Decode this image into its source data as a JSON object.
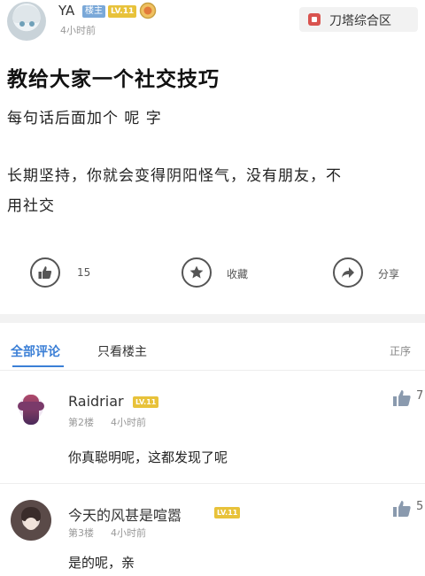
{
  "post": {
    "author": "YA",
    "author_badge": "楼主",
    "author_level": "LV.11",
    "time": "4小时前",
    "forum": "刀塔综合区",
    "title": "教给大家一个社交技巧",
    "body_lines": [
      "每句话后面加个 呢 字",
      "长期坚持，你就会变得阴阳怪气，没有朋友，不",
      "用社交"
    ],
    "actions": {
      "like_count": "15",
      "favorite_label": "收藏",
      "share_label": "分享"
    }
  },
  "tabs": {
    "all": "全部评论",
    "op_only": "只看楼主",
    "sort": "正序"
  },
  "comments": [
    {
      "name": "Raidriar",
      "level": "LV.11",
      "floor": "第2楼",
      "time": "4小时前",
      "text": "你真聪明呢，这都发现了呢",
      "likes": "7"
    },
    {
      "name": "今天的风甚是喧嚣",
      "level": "LV.11",
      "floor": "第3楼",
      "time": "4小时前",
      "text": "是的呢，亲",
      "likes": "5"
    }
  ],
  "colors": {
    "accent": "#3b7fd6",
    "level_badge": "#e8c23a",
    "op_badge": "#7aa8d8",
    "forum_icon": "#d9534f"
  },
  "icons": {
    "like": "thumbs-up-icon",
    "favorite": "star-icon",
    "share": "share-arrow-icon",
    "medal": "medal-icon",
    "forum": "forum-icon"
  }
}
